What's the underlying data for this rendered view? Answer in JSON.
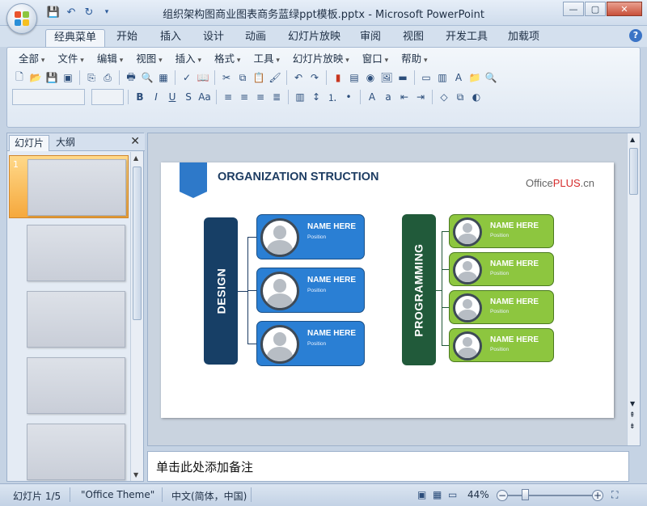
{
  "window": {
    "title": "组织架构图商业图表商务蓝绿ppt模板.pptx - Microsoft PowerPoint",
    "controls": {
      "minimize": "—",
      "maximize": "▢",
      "close": "✕"
    }
  },
  "quick_access": {
    "items": [
      "save-icon",
      "undo-icon",
      "redo-icon",
      "customize-icon"
    ]
  },
  "ribbon_tabs": [
    "经典菜单",
    "开始",
    "插入",
    "设计",
    "动画",
    "幻灯片放映",
    "审阅",
    "视图",
    "开发工具",
    "加载项"
  ],
  "help": "?",
  "classic_menu": [
    "全部",
    "文件",
    "编辑",
    "视图",
    "插入",
    "格式",
    "工具",
    "幻灯片放映",
    "窗口",
    "帮助"
  ],
  "left_pane": {
    "tabs": [
      "幻灯片",
      "大纲"
    ],
    "close": "✕",
    "selected_slide_number": "1",
    "slide_count_shown": 5
  },
  "slide": {
    "title": "ORGANIZATION STRUCTION",
    "brand": {
      "prefix": "Office",
      "highlight": "PLUS",
      "suffix": ".cn"
    },
    "groups": [
      {
        "label": "DESIGN",
        "bar_color": "#173f66",
        "card_color": "#2a7fd4",
        "members": [
          {
            "name": "NAME HERE",
            "position": "Position"
          },
          {
            "name": "NAME HERE",
            "position": "Position"
          },
          {
            "name": "NAME HERE",
            "position": "Position"
          }
        ]
      },
      {
        "label": "PROGRAMMING",
        "bar_color": "#215a3a",
        "card_color": "#8dc63f",
        "members": [
          {
            "name": "NAME HERE",
            "position": "Position"
          },
          {
            "name": "NAME HERE",
            "position": "Position"
          },
          {
            "name": "NAME HERE",
            "position": "Position"
          },
          {
            "name": "NAME HERE",
            "position": "Position"
          }
        ]
      }
    ]
  },
  "notes_placeholder": "单击此处添加备注",
  "status": {
    "slide_info": "幻灯片 1/5",
    "theme": "\"Office Theme\"",
    "language": "中文(简体，中国)",
    "zoom": "44%"
  }
}
